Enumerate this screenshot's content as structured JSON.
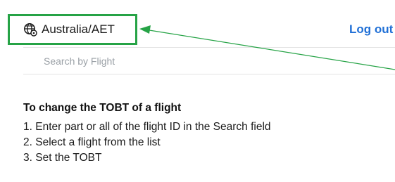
{
  "header": {
    "timezone_label": "Australia/AET",
    "logout_label": "Log out"
  },
  "search": {
    "placeholder": "Search by Flight",
    "value": ""
  },
  "instructions": {
    "title": "To change the TOBT of a flight",
    "steps": [
      "1. Enter part or all of the flight ID in the Search field",
      "2. Select a flight from the list",
      "3. Set the TOBT"
    ]
  },
  "colors": {
    "highlight_box": "#26a346",
    "annotation_arrow": "#26a346",
    "link": "#1f6fd6"
  },
  "icons": {
    "timezone": "globe-gear-icon"
  }
}
